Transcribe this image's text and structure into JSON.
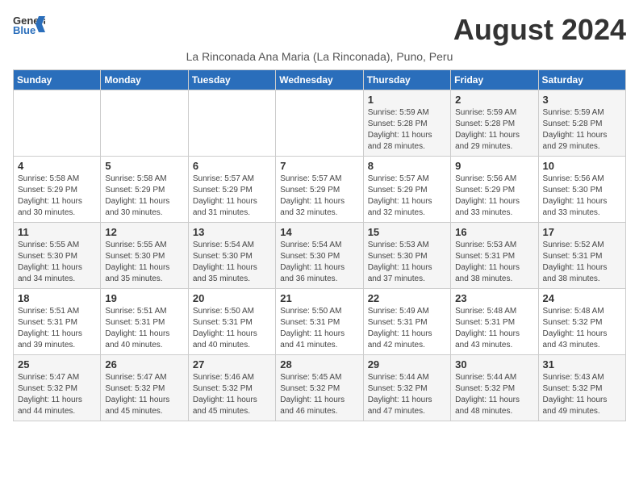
{
  "header": {
    "logo_general": "General",
    "logo_blue": "Blue",
    "title": "August 2024",
    "subtitle": "La Rinconada Ana Maria (La Rinconada), Puno, Peru"
  },
  "days_of_week": [
    "Sunday",
    "Monday",
    "Tuesday",
    "Wednesday",
    "Thursday",
    "Friday",
    "Saturday"
  ],
  "weeks": [
    [
      {
        "day": "",
        "info": ""
      },
      {
        "day": "",
        "info": ""
      },
      {
        "day": "",
        "info": ""
      },
      {
        "day": "",
        "info": ""
      },
      {
        "day": "1",
        "info": "Sunrise: 5:59 AM\nSunset: 5:28 PM\nDaylight: 11 hours and 28 minutes."
      },
      {
        "day": "2",
        "info": "Sunrise: 5:59 AM\nSunset: 5:28 PM\nDaylight: 11 hours and 29 minutes."
      },
      {
        "day": "3",
        "info": "Sunrise: 5:59 AM\nSunset: 5:28 PM\nDaylight: 11 hours and 29 minutes."
      }
    ],
    [
      {
        "day": "4",
        "info": "Sunrise: 5:58 AM\nSunset: 5:29 PM\nDaylight: 11 hours and 30 minutes."
      },
      {
        "day": "5",
        "info": "Sunrise: 5:58 AM\nSunset: 5:29 PM\nDaylight: 11 hours and 30 minutes."
      },
      {
        "day": "6",
        "info": "Sunrise: 5:57 AM\nSunset: 5:29 PM\nDaylight: 11 hours and 31 minutes."
      },
      {
        "day": "7",
        "info": "Sunrise: 5:57 AM\nSunset: 5:29 PM\nDaylight: 11 hours and 32 minutes."
      },
      {
        "day": "8",
        "info": "Sunrise: 5:57 AM\nSunset: 5:29 PM\nDaylight: 11 hours and 32 minutes."
      },
      {
        "day": "9",
        "info": "Sunrise: 5:56 AM\nSunset: 5:29 PM\nDaylight: 11 hours and 33 minutes."
      },
      {
        "day": "10",
        "info": "Sunrise: 5:56 AM\nSunset: 5:30 PM\nDaylight: 11 hours and 33 minutes."
      }
    ],
    [
      {
        "day": "11",
        "info": "Sunrise: 5:55 AM\nSunset: 5:30 PM\nDaylight: 11 hours and 34 minutes."
      },
      {
        "day": "12",
        "info": "Sunrise: 5:55 AM\nSunset: 5:30 PM\nDaylight: 11 hours and 35 minutes."
      },
      {
        "day": "13",
        "info": "Sunrise: 5:54 AM\nSunset: 5:30 PM\nDaylight: 11 hours and 35 minutes."
      },
      {
        "day": "14",
        "info": "Sunrise: 5:54 AM\nSunset: 5:30 PM\nDaylight: 11 hours and 36 minutes."
      },
      {
        "day": "15",
        "info": "Sunrise: 5:53 AM\nSunset: 5:30 PM\nDaylight: 11 hours and 37 minutes."
      },
      {
        "day": "16",
        "info": "Sunrise: 5:53 AM\nSunset: 5:31 PM\nDaylight: 11 hours and 38 minutes."
      },
      {
        "day": "17",
        "info": "Sunrise: 5:52 AM\nSunset: 5:31 PM\nDaylight: 11 hours and 38 minutes."
      }
    ],
    [
      {
        "day": "18",
        "info": "Sunrise: 5:51 AM\nSunset: 5:31 PM\nDaylight: 11 hours and 39 minutes."
      },
      {
        "day": "19",
        "info": "Sunrise: 5:51 AM\nSunset: 5:31 PM\nDaylight: 11 hours and 40 minutes."
      },
      {
        "day": "20",
        "info": "Sunrise: 5:50 AM\nSunset: 5:31 PM\nDaylight: 11 hours and 40 minutes."
      },
      {
        "day": "21",
        "info": "Sunrise: 5:50 AM\nSunset: 5:31 PM\nDaylight: 11 hours and 41 minutes."
      },
      {
        "day": "22",
        "info": "Sunrise: 5:49 AM\nSunset: 5:31 PM\nDaylight: 11 hours and 42 minutes."
      },
      {
        "day": "23",
        "info": "Sunrise: 5:48 AM\nSunset: 5:31 PM\nDaylight: 11 hours and 43 minutes."
      },
      {
        "day": "24",
        "info": "Sunrise: 5:48 AM\nSunset: 5:32 PM\nDaylight: 11 hours and 43 minutes."
      }
    ],
    [
      {
        "day": "25",
        "info": "Sunrise: 5:47 AM\nSunset: 5:32 PM\nDaylight: 11 hours and 44 minutes."
      },
      {
        "day": "26",
        "info": "Sunrise: 5:47 AM\nSunset: 5:32 PM\nDaylight: 11 hours and 45 minutes."
      },
      {
        "day": "27",
        "info": "Sunrise: 5:46 AM\nSunset: 5:32 PM\nDaylight: 11 hours and 45 minutes."
      },
      {
        "day": "28",
        "info": "Sunrise: 5:45 AM\nSunset: 5:32 PM\nDaylight: 11 hours and 46 minutes."
      },
      {
        "day": "29",
        "info": "Sunrise: 5:44 AM\nSunset: 5:32 PM\nDaylight: 11 hours and 47 minutes."
      },
      {
        "day": "30",
        "info": "Sunrise: 5:44 AM\nSunset: 5:32 PM\nDaylight: 11 hours and 48 minutes."
      },
      {
        "day": "31",
        "info": "Sunrise: 5:43 AM\nSunset: 5:32 PM\nDaylight: 11 hours and 49 minutes."
      }
    ]
  ]
}
